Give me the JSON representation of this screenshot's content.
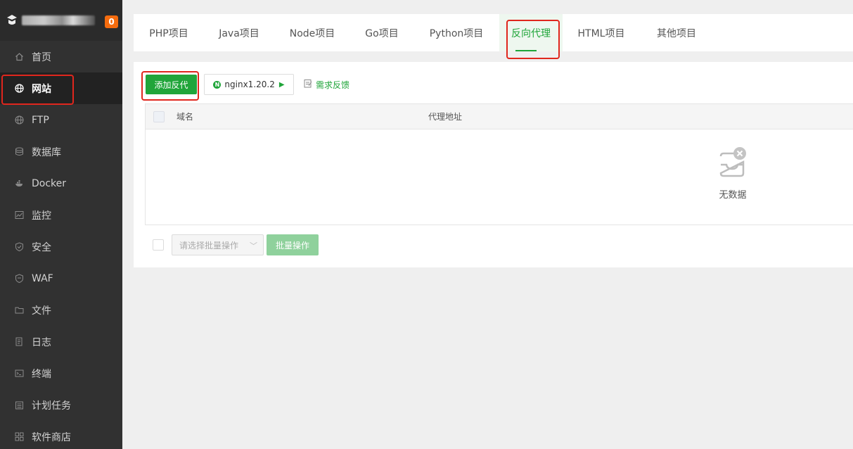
{
  "brand": {
    "badge": "0"
  },
  "sidebar": {
    "items": [
      {
        "label": "首页",
        "icon": "home-icon"
      },
      {
        "label": "网站",
        "icon": "globe-icon"
      },
      {
        "label": "FTP",
        "icon": "ftp-globe-icon"
      },
      {
        "label": "数据库",
        "icon": "database-icon"
      },
      {
        "label": "Docker",
        "icon": "docker-icon"
      },
      {
        "label": "监控",
        "icon": "monitor-icon"
      },
      {
        "label": "安全",
        "icon": "shield-icon"
      },
      {
        "label": "WAF",
        "icon": "waf-shield-icon"
      },
      {
        "label": "文件",
        "icon": "folder-icon"
      },
      {
        "label": "日志",
        "icon": "log-icon"
      },
      {
        "label": "终端",
        "icon": "terminal-icon"
      },
      {
        "label": "计划任务",
        "icon": "calendar-icon"
      },
      {
        "label": "软件商店",
        "icon": "apps-icon"
      }
    ],
    "active_index": 1
  },
  "tabs": [
    {
      "label": "PHP项目"
    },
    {
      "label": "Java项目"
    },
    {
      "label": "Node项目"
    },
    {
      "label": "Go项目"
    },
    {
      "label": "Python项目"
    },
    {
      "label": "反向代理"
    },
    {
      "label": "HTML项目"
    },
    {
      "label": "其他项目"
    }
  ],
  "active_tab_index": 5,
  "toolbar": {
    "add_label": "添加反代",
    "nginx_label": "nginx1.20.2",
    "nginx_icon_letter": "N",
    "feedback_label": "需求反馈"
  },
  "table": {
    "columns": [
      "域名",
      "代理地址"
    ],
    "empty_text": "无数据"
  },
  "footer": {
    "select_placeholder": "请选择批量操作",
    "batch_label": "批量操作"
  },
  "colors": {
    "accent": "#20a53a",
    "sidebar_bg": "#313131",
    "highlight_red": "#e0261d"
  }
}
